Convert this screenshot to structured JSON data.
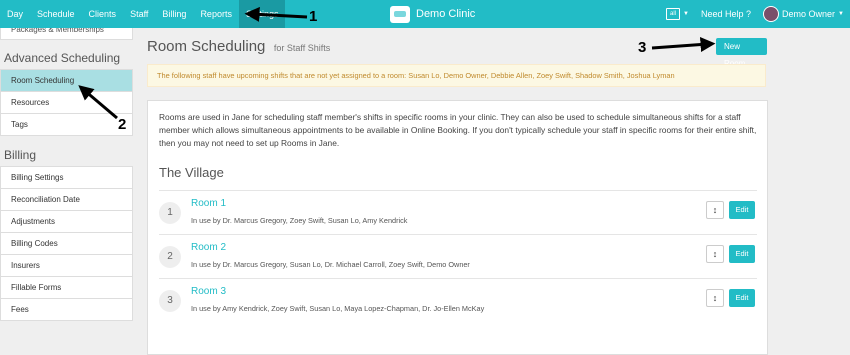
{
  "nav": {
    "items": [
      {
        "label": "Day"
      },
      {
        "label": "Schedule"
      },
      {
        "label": "Clients"
      },
      {
        "label": "Staff"
      },
      {
        "label": "Billing"
      },
      {
        "label": "Reports"
      },
      {
        "label": "Settings",
        "active": true
      }
    ],
    "brand": "Demo Clinic",
    "calendar_icon_text": "all",
    "help": "Need Help ?",
    "user": "Demo Owner"
  },
  "sidebar": {
    "cut_item": "Packages & Memberships",
    "advanced_heading": "Advanced Scheduling",
    "advanced_items": [
      {
        "label": "Room Scheduling",
        "active": true
      },
      {
        "label": "Resources"
      },
      {
        "label": "Tags"
      }
    ],
    "billing_heading": "Billing",
    "billing_items": [
      {
        "label": "Billing Settings"
      },
      {
        "label": "Reconciliation Date"
      },
      {
        "label": "Adjustments"
      },
      {
        "label": "Billing Codes"
      },
      {
        "label": "Insurers"
      },
      {
        "label": "Fillable Forms"
      },
      {
        "label": "Fees"
      }
    ]
  },
  "main": {
    "title": "Room Scheduling",
    "subtitle": "for Staff Shifts",
    "new_room_label": "New Room",
    "alert": "The following staff have upcoming shifts that are not yet assigned to a room: Susan Lo, Demo Owner, Debbie Allen, Zoey Swift, Shadow Smith, Joshua Lyman",
    "intro": "Rooms are used in Jane for scheduling staff member's shifts in specific rooms in your clinic. They can also be used to schedule simultaneous shifts for a staff member which allows simultaneous appointments to be available in Online Booking. If you don't typically schedule your staff in specific rooms for their entire shift, then you may not need to set up Rooms in Jane.",
    "location": "The Village",
    "edit_label": "Edit",
    "rooms": [
      {
        "num": "1",
        "name": "Room 1",
        "in_use": "In use by Dr. Marcus Gregory, Zoey Swift, Susan Lo, Amy Kendrick"
      },
      {
        "num": "2",
        "name": "Room 2",
        "in_use": "In use by Dr. Marcus Gregory, Susan Lo, Dr. Michael Carroll, Zoey Swift, Demo Owner"
      },
      {
        "num": "3",
        "name": "Room 3",
        "in_use": "In use by Amy Kendrick, Zoey Swift, Susan Lo, Maya Lopez-Chapman, Dr. Jo-Ellen McKay"
      }
    ]
  },
  "annotations": [
    "1",
    "2",
    "3"
  ],
  "colors": {
    "accent": "#22bcc6",
    "active_sidebar": "#a9dfe3",
    "alert_bg": "#fcf8e3"
  }
}
